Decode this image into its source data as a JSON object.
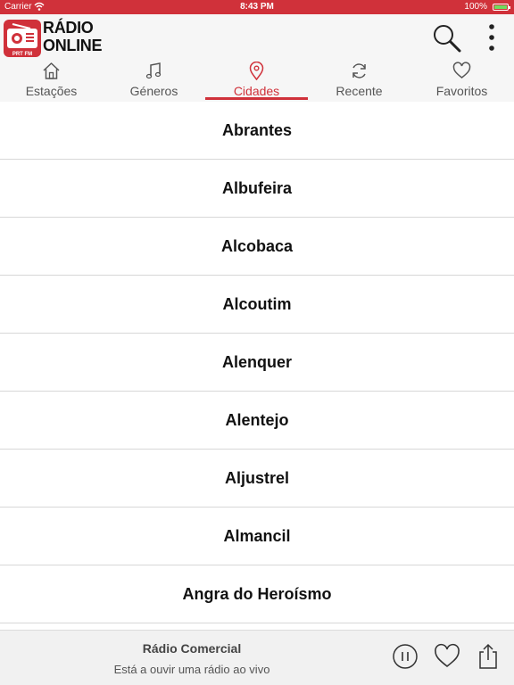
{
  "status_bar": {
    "carrier": "Carrier",
    "time": "8:43 PM",
    "battery": "100%",
    "battery_level": 1.0
  },
  "header": {
    "logo_line1": "RÁDIO",
    "logo_line2": "ONLINE",
    "logo_badge": "PRT FM",
    "search_icon": "search-icon",
    "more_icon": "more-vertical-icon"
  },
  "tabs": [
    {
      "label": "Estações",
      "icon": "home-icon",
      "active": false
    },
    {
      "label": "Géneros",
      "icon": "music-note-icon",
      "active": false
    },
    {
      "label": "Cidades",
      "icon": "location-pin-icon",
      "active": true
    },
    {
      "label": "Recente",
      "icon": "refresh-icon",
      "active": false
    },
    {
      "label": "Favoritos",
      "icon": "heart-icon",
      "active": false
    }
  ],
  "cities": [
    "Abrantes",
    "Albufeira",
    "Alcobaca",
    "Alcoutim",
    "Alenquer",
    "Alentejo",
    "Aljustrel",
    "Almancil",
    "Angra do Heroísmo"
  ],
  "player": {
    "station": "Rádio Comercial",
    "status": "Está a ouvir uma rádio ao vivo",
    "buttons": [
      "pause-icon",
      "heart-icon",
      "share-icon"
    ]
  },
  "colors": {
    "accent": "#d0313a",
    "header_bg": "#f6f6f6",
    "player_bg": "#f1f1f1"
  }
}
